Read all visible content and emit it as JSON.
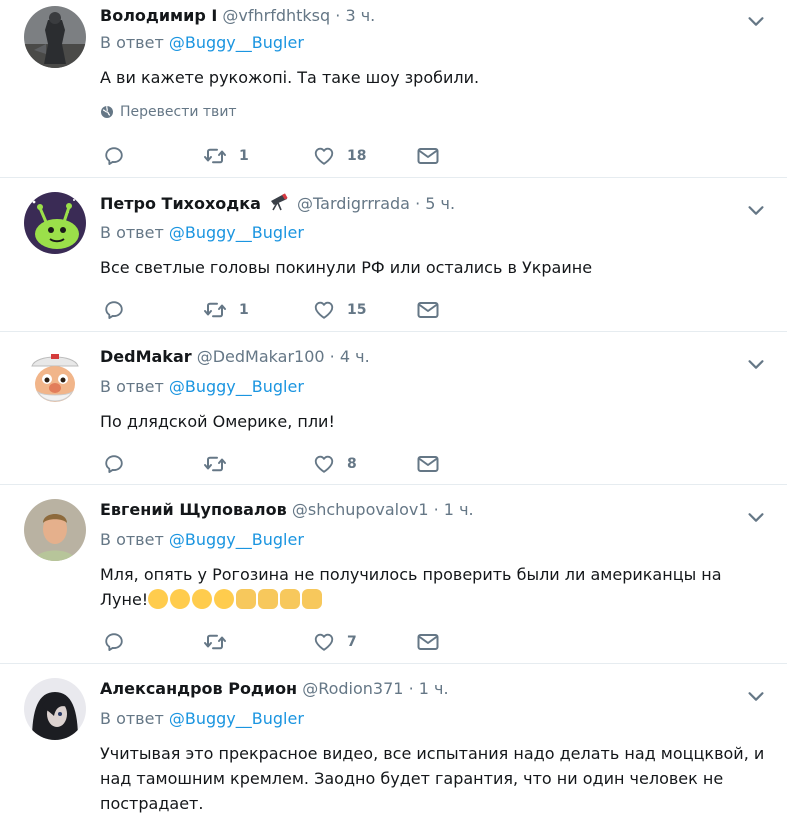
{
  "tweets": [
    {
      "name": "Володимир І",
      "handle": "@vfhrfdhtksq",
      "time": "3 ч.",
      "reply_label": "В ответ",
      "reply_to": "@Buggy__Bugler",
      "text": "А ви кажете рукожопі. Та таке шоу зробили.",
      "translate": "Перевести твит",
      "retweets": "1",
      "likes": "18"
    },
    {
      "name": "Петро Тихоходка",
      "handle": "@Tardigrrrada",
      "time": "5 ч.",
      "reply_label": "В ответ",
      "reply_to": "@Buggy__Bugler",
      "text": "Все светлые головы покинули РФ или остались в Украине",
      "retweets": "1",
      "likes": "15"
    },
    {
      "name": "DedMakar",
      "handle": "@DedMakar100",
      "time": "4 ч.",
      "reply_label": "В ответ",
      "reply_to": "@Buggy__Bugler",
      "text": "По длядской Омерике, пли!",
      "retweets": "",
      "likes": "8"
    },
    {
      "name": "Евгений Щуповалов",
      "handle": "@shchupovalov1",
      "time": "1 ч.",
      "reply_label": "В ответ",
      "reply_to": "@Buggy__Bugler",
      "text1": "Мля, опять у Рогозина не получилось проверить были ли американцы на",
      "text2": "Луне!",
      "retweets": "",
      "likes": "7"
    },
    {
      "name": "Александров Родион",
      "handle": "@Rodion371",
      "time": "1 ч.",
      "reply_label": "В ответ",
      "reply_to": "@Buggy__Bugler",
      "text": "Учитывая это прекрасное видео, все испытания надо делать над моццквой, и над тамошним кремлем. Заодно будет гарантия, что ни один человек не пострадает."
    }
  ],
  "colors": {
    "text": "#14171a",
    "muted": "#657786",
    "link": "#1b95e0",
    "border": "#e6ecf0"
  },
  "icons": [
    "chevron-down-icon",
    "reply-icon",
    "retweet-icon",
    "like-icon",
    "message-icon",
    "globe-icon",
    "telescope-emoji"
  ]
}
